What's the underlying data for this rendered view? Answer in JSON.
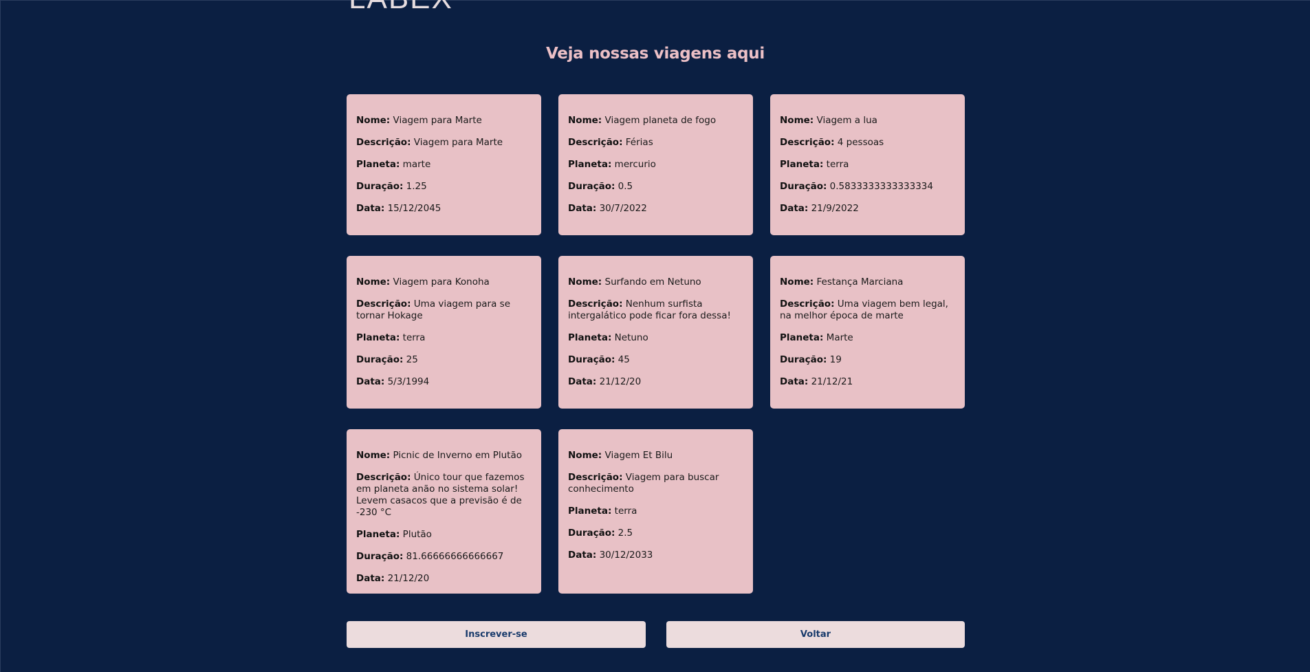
{
  "header": {
    "logo_text": "LABEX",
    "title": "Veja nossas viagens aqui"
  },
  "labels": {
    "name": "Nome:",
    "description": "Descrição:",
    "planet": "Planeta:",
    "duration": "Duração:",
    "date": "Data:"
  },
  "trips": [
    {
      "name": "Viagem para Marte",
      "description": "Viagem para Marte",
      "planet": "marte",
      "duration": "1.25",
      "date": "15/12/2045"
    },
    {
      "name": "Viagem planeta de fogo",
      "description": "Férias",
      "planet": "mercurio",
      "duration": "0.5",
      "date": "30/7/2022"
    },
    {
      "name": "Viagem a lua",
      "description": "4 pessoas",
      "planet": "terra",
      "duration": "0.5833333333333334",
      "date": "21/9/2022"
    },
    {
      "name": "Viagem para Konoha",
      "description": "Uma viagem para se tornar Hokage",
      "planet": "terra",
      "duration": "25",
      "date": "5/3/1994"
    },
    {
      "name": "Surfando em Netuno",
      "description": "Nenhum surfista intergalático pode ficar fora dessa!",
      "planet": "Netuno",
      "duration": "45",
      "date": "21/12/20"
    },
    {
      "name": "Festança Marciana",
      "description": "Uma viagem bem legal, na melhor época de marte",
      "planet": "Marte",
      "duration": "19",
      "date": "21/12/21"
    },
    {
      "name": "Picnic de Inverno em Plutão",
      "description": "Único tour que fazemos em planeta anão no sistema solar! Levem casacos que a previsão é de -230 °C",
      "planet": "Plutão",
      "duration": "81.66666666666667",
      "date": "21/12/20"
    },
    {
      "name": "Viagem Et Bilu",
      "description": "Viagem para buscar conhecimento",
      "planet": "terra",
      "duration": "2.5",
      "date": "30/12/2033"
    }
  ],
  "actions": {
    "subscribe_label": "Inscrever-se",
    "back_label": "Voltar"
  }
}
